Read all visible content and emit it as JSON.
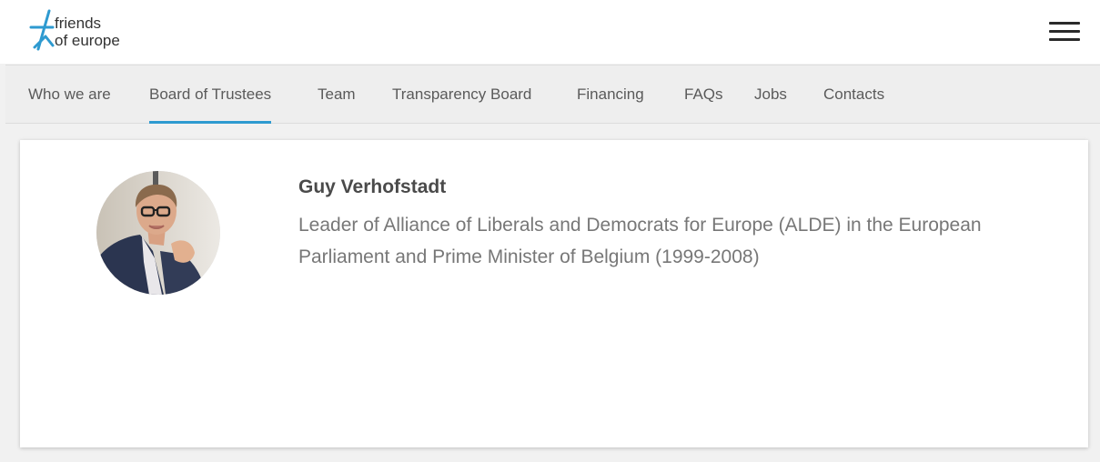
{
  "header": {
    "logo": {
      "line1": "friends",
      "line2": "of europe",
      "icon": "star-logo-icon",
      "color": "#2e9ad0"
    },
    "menu_icon": "hamburger-menu-icon"
  },
  "nav": {
    "active_color": "#2e9ad0",
    "tabs": [
      {
        "label": "Who we are"
      },
      {
        "label": "Board of Trustees",
        "active": true
      },
      {
        "label": "Team"
      },
      {
        "label": "Transparency Board"
      },
      {
        "label": "Financing"
      },
      {
        "label": "FAQs"
      },
      {
        "label": "Jobs"
      },
      {
        "label": "Contacts"
      }
    ]
  },
  "profile": {
    "name": "Guy Verhofstadt",
    "description": "Leader of Alliance of Liberals and Democrats for Europe (ALDE) in the European Parliament and Prime Minister of Belgium (1999-2008)"
  }
}
